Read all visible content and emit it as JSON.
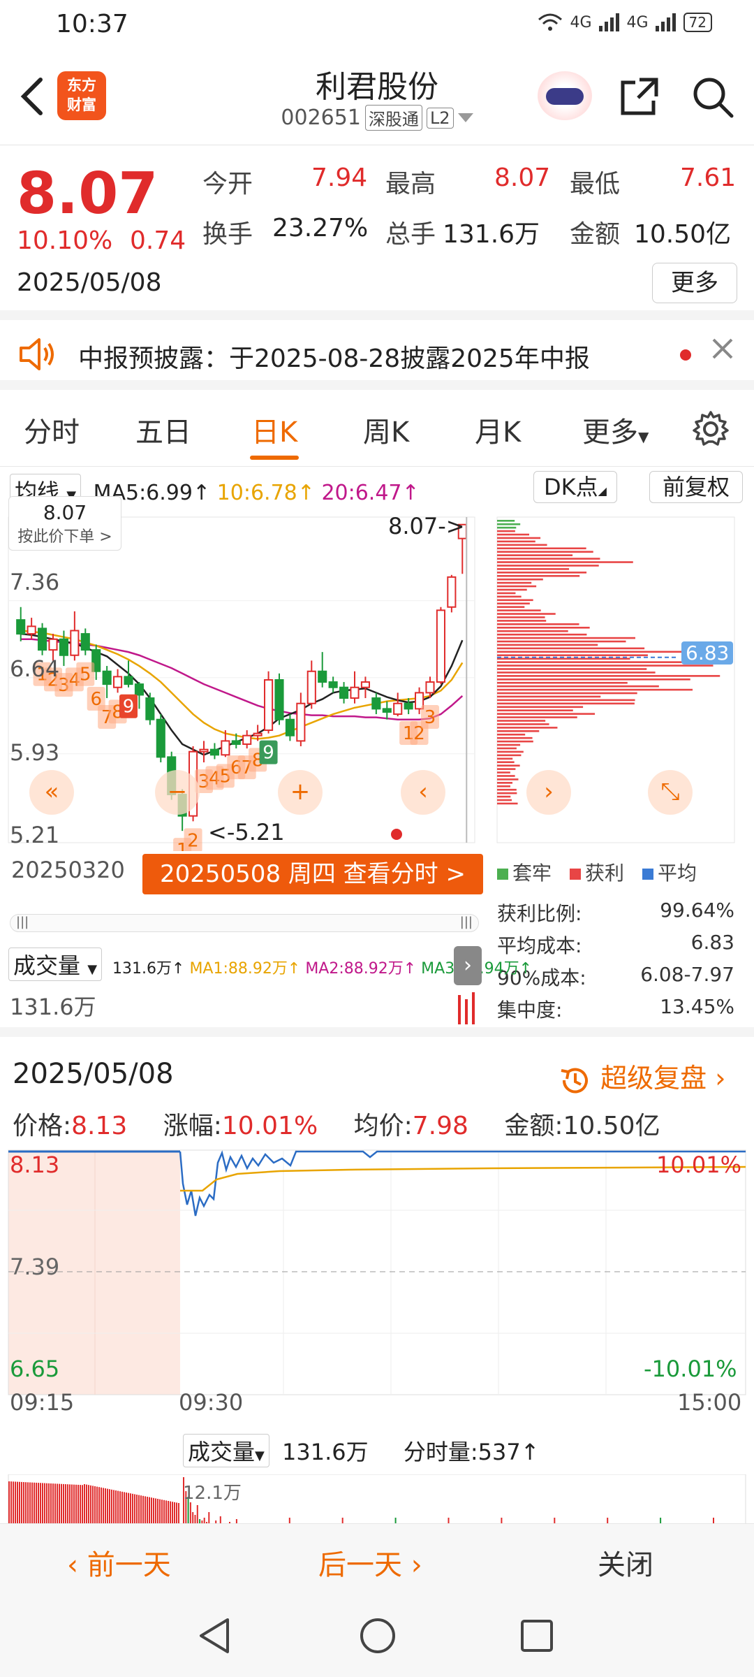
{
  "status_bar": {
    "time": "10:37",
    "network1": "4G",
    "network2": "4G",
    "battery": "72"
  },
  "header": {
    "logo_line1": "东方",
    "logo_line2": "财富",
    "stock_name": "利君股份",
    "stock_code": "002651",
    "tag_connect": "深股通",
    "tag_level": "L2"
  },
  "quote": {
    "price": "8.07",
    "change_pct": "10.10%",
    "change_val": "0.74",
    "date": "2025/05/08",
    "open_label": "今开",
    "open": "7.94",
    "high_label": "最高",
    "high": "8.07",
    "low_label": "最低",
    "low": "7.61",
    "turnover_label": "换手",
    "turnover": "23.27%",
    "volume_label": "总手",
    "volume": "131.6万",
    "amount_label": "金额",
    "amount": "10.50亿",
    "more": "更多"
  },
  "notice": {
    "text": "中报预披露：于2025-08-28披露2025年中报"
  },
  "tabs": [
    "分时",
    "五日",
    "日K",
    "周K",
    "月K",
    "更多"
  ],
  "tabs_active": "日K",
  "kchart": {
    "indicator": "均线",
    "ma5": "MA5:6.99↑",
    "ma10": "10:6.78↑",
    "ma20": "20:6.47↑",
    "dk_button": "DK点",
    "adjust_button": "前复权",
    "tip_price": "8.07",
    "tip_action": "按此价下单 >",
    "y_labels": [
      "7.36",
      "6.64",
      "5.93",
      "5.21"
    ],
    "high_marker": "8.07->",
    "low_marker": "<-5.21",
    "cost_line": "6.83",
    "start_date": "20250320",
    "selected_date_btn": "20250508 周四 查看分时 >",
    "chip_legend": [
      "套牢",
      "获利",
      "平均"
    ],
    "chip_stats": [
      {
        "label": "获利比例:",
        "value": "99.64%"
      },
      {
        "label": "平均成本:",
        "value": "6.83"
      },
      {
        "label": "90%成本:",
        "value": "6.08-7.97"
      },
      {
        "label": "集中度:",
        "value": "13.45%"
      }
    ],
    "volume_select": "成交量",
    "volume_total": "131.6万↑",
    "vol_ma1": "MA1:88.92万↑",
    "vol_ma2": "MA2:88.92万↑",
    "vol_ma3": "MA3:30.94万↑",
    "volume_axis": "131.6万",
    "candles": [
      {
        "o": 7.18,
        "c": 7.05,
        "h": 7.3,
        "l": 6.98
      },
      {
        "o": 7.05,
        "c": 7.12,
        "h": 7.2,
        "l": 7.0
      },
      {
        "o": 7.1,
        "c": 6.9,
        "h": 7.15,
        "l": 6.85
      },
      {
        "o": 6.9,
        "c": 7.0,
        "h": 7.05,
        "l": 6.8
      },
      {
        "o": 7.0,
        "c": 6.85,
        "h": 7.08,
        "l": 6.75
      },
      {
        "o": 6.85,
        "c": 7.08,
        "h": 7.26,
        "l": 6.8
      },
      {
        "o": 7.05,
        "c": 6.9,
        "h": 7.1,
        "l": 6.85
      },
      {
        "o": 6.9,
        "c": 6.7,
        "h": 6.95,
        "l": 6.62
      },
      {
        "o": 6.7,
        "c": 6.58,
        "h": 6.75,
        "l": 6.45
      },
      {
        "o": 6.55,
        "c": 6.65,
        "h": 6.72,
        "l": 6.5
      },
      {
        "o": 6.65,
        "c": 6.58,
        "h": 6.8,
        "l": 6.55
      },
      {
        "o": 6.58,
        "c": 6.48,
        "h": 6.6,
        "l": 6.35
      },
      {
        "o": 6.45,
        "c": 6.25,
        "h": 6.5,
        "l": 6.2
      },
      {
        "o": 6.25,
        "c": 5.9,
        "h": 6.3,
        "l": 5.85
      },
      {
        "o": 5.9,
        "c": 5.55,
        "h": 5.95,
        "l": 5.5
      },
      {
        "o": 5.55,
        "c": 5.35,
        "h": 5.6,
        "l": 5.21
      },
      {
        "o": 5.35,
        "c": 5.95,
        "h": 6.0,
        "l": 5.3
      },
      {
        "o": 5.95,
        "c": 5.97,
        "h": 6.05,
        "l": 5.85
      },
      {
        "o": 5.97,
        "c": 5.92,
        "h": 6.03,
        "l": 5.88
      },
      {
        "o": 5.92,
        "c": 6.05,
        "h": 6.15,
        "l": 5.9
      },
      {
        "o": 6.05,
        "c": 6.02,
        "h": 6.12,
        "l": 5.98
      },
      {
        "o": 6.02,
        "c": 6.1,
        "h": 6.15,
        "l": 5.98
      },
      {
        "o": 6.1,
        "c": 6.12,
        "h": 6.2,
        "l": 6.05
      },
      {
        "o": 6.15,
        "c": 6.62,
        "h": 6.7,
        "l": 6.12
      },
      {
        "o": 6.62,
        "c": 6.25,
        "h": 6.68,
        "l": 6.2
      },
      {
        "o": 6.25,
        "c": 6.1,
        "h": 6.3,
        "l": 6.05
      },
      {
        "o": 6.05,
        "c": 6.4,
        "h": 6.5,
        "l": 6.0
      },
      {
        "o": 6.4,
        "c": 6.7,
        "h": 6.8,
        "l": 6.35
      },
      {
        "o": 6.7,
        "c": 6.6,
        "h": 6.88,
        "l": 6.55
      },
      {
        "o": 6.6,
        "c": 6.55,
        "h": 6.65,
        "l": 6.5
      },
      {
        "o": 6.55,
        "c": 6.45,
        "h": 6.6,
        "l": 6.4
      },
      {
        "o": 6.45,
        "c": 6.55,
        "h": 6.7,
        "l": 6.4
      },
      {
        "o": 6.55,
        "c": 6.6,
        "h": 6.65,
        "l": 6.45
      },
      {
        "o": 6.45,
        "c": 6.35,
        "h": 6.5,
        "l": 6.3
      },
      {
        "o": 6.35,
        "c": 6.32,
        "h": 6.42,
        "l": 6.25
      },
      {
        "o": 6.3,
        "c": 6.4,
        "h": 6.5,
        "l": 6.28
      },
      {
        "o": 6.4,
        "c": 6.35,
        "h": 6.45,
        "l": 6.3
      },
      {
        "o": 6.35,
        "c": 6.5,
        "h": 6.55,
        "l": 6.3
      },
      {
        "o": 6.5,
        "c": 6.6,
        "h": 6.65,
        "l": 6.45
      },
      {
        "o": 6.6,
        "c": 7.27,
        "h": 7.3,
        "l": 6.58
      },
      {
        "o": 7.3,
        "c": 7.58,
        "h": 7.6,
        "l": 7.25
      },
      {
        "o": 7.94,
        "c": 8.07,
        "h": 8.07,
        "l": 7.61
      }
    ],
    "ma_black": [
      7.05,
      7.04,
      7.02,
      7.0,
      6.98,
      6.96,
      6.92,
      6.88,
      6.84,
      6.76,
      6.68,
      6.58,
      6.45,
      6.3,
      6.15,
      6.02,
      5.97,
      5.92,
      5.96,
      6.0,
      6.04,
      6.08,
      6.12,
      6.18,
      6.26,
      6.3,
      6.34,
      6.4,
      6.44,
      6.5,
      6.52,
      6.53,
      6.54,
      6.5,
      6.46,
      6.43,
      6.41,
      6.42,
      6.46,
      6.56,
      6.75,
      6.99
    ],
    "ma_orange": [
      7.08,
      7.07,
      7.06,
      7.04,
      7.02,
      7.0,
      6.97,
      6.94,
      6.9,
      6.86,
      6.81,
      6.75,
      6.68,
      6.6,
      6.5,
      6.4,
      6.3,
      6.22,
      6.16,
      6.12,
      6.1,
      6.08,
      6.07,
      6.08,
      6.1,
      6.14,
      6.18,
      6.22,
      6.26,
      6.3,
      6.33,
      6.36,
      6.38,
      6.4,
      6.42,
      6.43,
      6.44,
      6.45,
      6.47,
      6.52,
      6.62,
      6.78
    ],
    "ma_magenta": [
      7.0,
      7.0,
      6.99,
      6.98,
      6.97,
      6.96,
      6.95,
      6.94,
      6.92,
      6.9,
      6.88,
      6.85,
      6.81,
      6.77,
      6.73,
      6.68,
      6.63,
      6.58,
      6.54,
      6.5,
      6.46,
      6.42,
      6.38,
      6.35,
      6.33,
      6.31,
      6.3,
      6.29,
      6.29,
      6.28,
      6.28,
      6.28,
      6.27,
      6.27,
      6.26,
      6.25,
      6.25,
      6.25,
      6.26,
      6.3,
      6.38,
      6.47
    ],
    "marker_labels": [
      {
        "i": 2,
        "t": "1"
      },
      {
        "i": 3,
        "t": "2"
      },
      {
        "i": 4,
        "t": "3"
      },
      {
        "i": 5,
        "t": "4"
      },
      {
        "i": 6,
        "t": "5"
      },
      {
        "i": 7,
        "t": "6"
      },
      {
        "i": 8,
        "t": "7"
      },
      {
        "i": 9,
        "t": "8"
      },
      {
        "i": 10,
        "t": "9"
      },
      {
        "i": 15,
        "t": "1"
      },
      {
        "i": 16,
        "t": "2"
      },
      {
        "i": 17,
        "t": "3"
      },
      {
        "i": 18,
        "t": "4"
      },
      {
        "i": 19,
        "t": "5"
      },
      {
        "i": 20,
        "t": "6"
      },
      {
        "i": 21,
        "t": "7"
      },
      {
        "i": 22,
        "t": "8"
      },
      {
        "i": 23,
        "t": "9"
      },
      {
        "i": 36,
        "t": "1"
      },
      {
        "i": 37,
        "t": "2"
      },
      {
        "i": 38,
        "t": "3"
      }
    ]
  },
  "intraday": {
    "date": "2025/05/08",
    "replay": "超级复盘",
    "price_label": "价格:",
    "price": "8.13",
    "change_label": "涨幅:",
    "change": "10.01%",
    "avg_label": "均价:",
    "avg": "7.98",
    "amount_label": "金额:",
    "amount": "10.50亿",
    "y_top": "8.13",
    "y_mid": "7.39",
    "y_bottom": "6.65",
    "pct_top": "10.01%",
    "pct_bottom": "-10.01%",
    "time_start": "09:15",
    "time_open": "09:30",
    "time_end": "15:00",
    "volume_select": "成交量",
    "volume_total": "131.6万",
    "tick_volume": "分时量:537↑",
    "vol_peak": "12.1万"
  },
  "bottom_bar": {
    "prev": "前一天",
    "next": "后一天",
    "close": "关闭"
  },
  "colors": {
    "up": "#e02b2b",
    "down": "#1a9a3a",
    "accent": "#ee6a00"
  }
}
